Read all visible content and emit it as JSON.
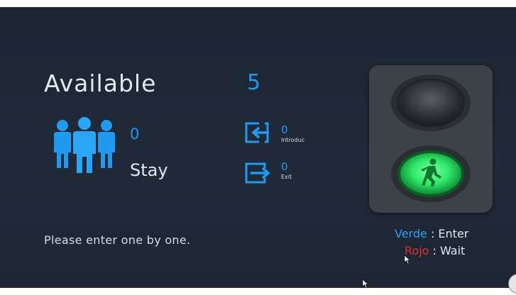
{
  "availability": {
    "label": "Available",
    "value": "5"
  },
  "occupancy": {
    "count": "0",
    "label": "Stay"
  },
  "entry": {
    "count": "0",
    "label": "Introduc"
  },
  "exit": {
    "count": "0",
    "label": "Exit"
  },
  "instructions": "Please enter one by one.",
  "legend": {
    "green_key": "Verde",
    "green_text": ": Enter",
    "red_key": "Rojo",
    "red_text": ": Wait"
  },
  "traffic_light": {
    "active_signal": "green-walk"
  },
  "colors": {
    "accent": "#1e9af0",
    "green": "#2ee86a",
    "red": "#e02d2d",
    "background": "#1f2836"
  },
  "icons": [
    "people-group-icon",
    "enter-arrow-icon",
    "exit-arrow-icon",
    "walking-person-icon",
    "mouse-cursor-icon"
  ]
}
